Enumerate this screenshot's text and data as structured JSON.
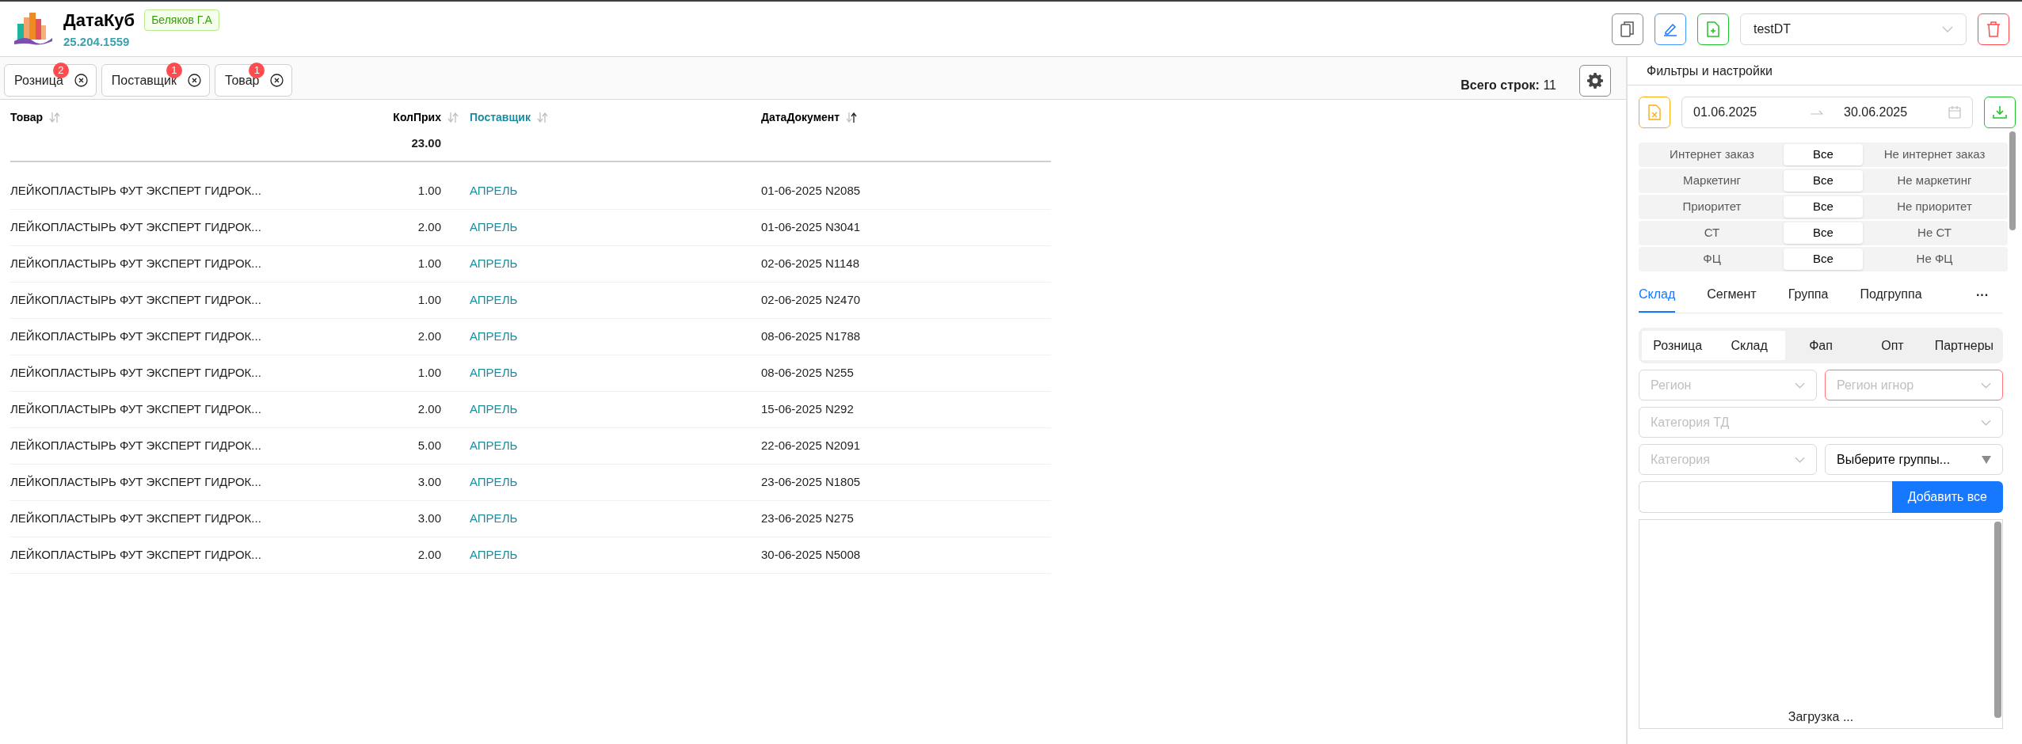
{
  "header": {
    "app_name": "ДатаКуб",
    "version": "25.204.1559",
    "user_badge": "Беляков Г.А",
    "report_select": {
      "value": "testDT"
    }
  },
  "tabs": [
    {
      "label": "Розница",
      "count": "2"
    },
    {
      "label": "Поставщик",
      "count": "1"
    },
    {
      "label": "Товар",
      "count": "1"
    }
  ],
  "total_rows": "**Всего строк:** 11",
  "table": {
    "columns": [
      {
        "label": "Товар",
        "kind": "text",
        "sorted_ascending": false
      },
      {
        "label": "КолПрих",
        "kind": "number",
        "sorted_ascending": false,
        "total": "23.00"
      },
      {
        "label": "Поставщик",
        "kind": "link",
        "sorted_ascending": false
      },
      {
        "label": "ДатаДокумент",
        "kind": "text",
        "sorted_ascending": true
      }
    ],
    "rows": [
      [
        "ЛЕЙКОПЛАСТЫРЬ ФУТ ЭКСПЕРТ ГИДРОК...",
        "1.00",
        "АПРЕЛЬ",
        "01-06-2025 N2085"
      ],
      [
        "ЛЕЙКОПЛАСТЫРЬ ФУТ ЭКСПЕРТ ГИДРОК...",
        "2.00",
        "АПРЕЛЬ",
        "01-06-2025 N3041"
      ],
      [
        "ЛЕЙКОПЛАСТЫРЬ ФУТ ЭКСПЕРТ ГИДРОК...",
        "1.00",
        "АПРЕЛЬ",
        "02-06-2025 N1148"
      ],
      [
        "ЛЕЙКОПЛАСТЫРЬ ФУТ ЭКСПЕРТ ГИДРОК...",
        "1.00",
        "АПРЕЛЬ",
        "02-06-2025 N2470"
      ],
      [
        "ЛЕЙКОПЛАСТЫРЬ ФУТ ЭКСПЕРТ ГИДРОК...",
        "2.00",
        "АПРЕЛЬ",
        "08-06-2025 N1788"
      ],
      [
        "ЛЕЙКОПЛАСТЫРЬ ФУТ ЭКСПЕРТ ГИДРОК...",
        "1.00",
        "АПРЕЛЬ",
        "08-06-2025 N255"
      ],
      [
        "ЛЕЙКОПЛАСТЫРЬ ФУТ ЭКСПЕРТ ГИДРОК...",
        "2.00",
        "АПРЕЛЬ",
        "15-06-2025 N292"
      ],
      [
        "ЛЕЙКОПЛАСТЫРЬ ФУТ ЭКСПЕРТ ГИДРОК...",
        "5.00",
        "АПРЕЛЬ",
        "22-06-2025 N2091"
      ],
      [
        "ЛЕЙКОПЛАСТЫРЬ ФУТ ЭКСПЕРТ ГИДРОК...",
        "3.00",
        "АПРЕЛЬ",
        "23-06-2025 N1805"
      ],
      [
        "ЛЕЙКОПЛАСТЫРЬ ФУТ ЭКСПЕРТ ГИДРОК...",
        "3.00",
        "АПРЕЛЬ",
        "23-06-2025 N275"
      ],
      [
        "ЛЕЙКОПЛАСТЫРЬ ФУТ ЭКСПЕРТ ГИДРОК...",
        "2.00",
        "АПРЕЛЬ",
        "30-06-2025 N5008"
      ]
    ]
  },
  "filters_panel": {
    "title": "Фильтры и настройки",
    "date_from": "01.06.2025",
    "date_to": "30.06.2025",
    "toggles": [
      {
        "options": [
          {
            "label": "Интернет заказ",
            "selected": false
          },
          {
            "label": "Все",
            "selected": true
          },
          {
            "label": "Не интернет заказ",
            "selected": false
          }
        ]
      },
      {
        "options": [
          {
            "label": "Маркетинг",
            "selected": false
          },
          {
            "label": "Все",
            "selected": true
          },
          {
            "label": "Не маркетинг",
            "selected": false
          }
        ]
      },
      {
        "options": [
          {
            "label": "Приоритет",
            "selected": false
          },
          {
            "label": "Все",
            "selected": true
          },
          {
            "label": "Не приоритет",
            "selected": false
          }
        ]
      },
      {
        "options": [
          {
            "label": "СТ",
            "selected": false
          },
          {
            "label": "Все",
            "selected": true
          },
          {
            "label": "Не СТ",
            "selected": false
          }
        ]
      },
      {
        "options": [
          {
            "label": "ФЦ",
            "selected": false
          },
          {
            "label": "Все",
            "selected": true
          },
          {
            "label": "Не ФЦ",
            "selected": false
          }
        ]
      }
    ],
    "tabs": [
      {
        "label": "Склад",
        "selected": true
      },
      {
        "label": "Сегмент",
        "selected": false
      },
      {
        "label": "Группа",
        "selected": false
      },
      {
        "label": "Подгруппа",
        "selected": false
      }
    ],
    "more_tabs": "···",
    "segments": [
      {
        "label": "Розница",
        "selected": true
      },
      {
        "label": "Склад",
        "selected": true
      },
      {
        "label": "Фап",
        "selected": false
      },
      {
        "label": "Опт",
        "selected": false
      },
      {
        "label": "Партнеры",
        "selected": false
      }
    ],
    "region": {
      "placeholder": "Регион"
    },
    "region_ignore": {
      "placeholder": "Регион игнор"
    },
    "category_td": {
      "placeholder": "Категория ТД"
    },
    "category": {
      "placeholder": "Категория"
    },
    "groups": {
      "value": "Выберите группы..."
    },
    "add_all_button": "Добавить все",
    "list_status": "Загрузка ..."
  }
}
